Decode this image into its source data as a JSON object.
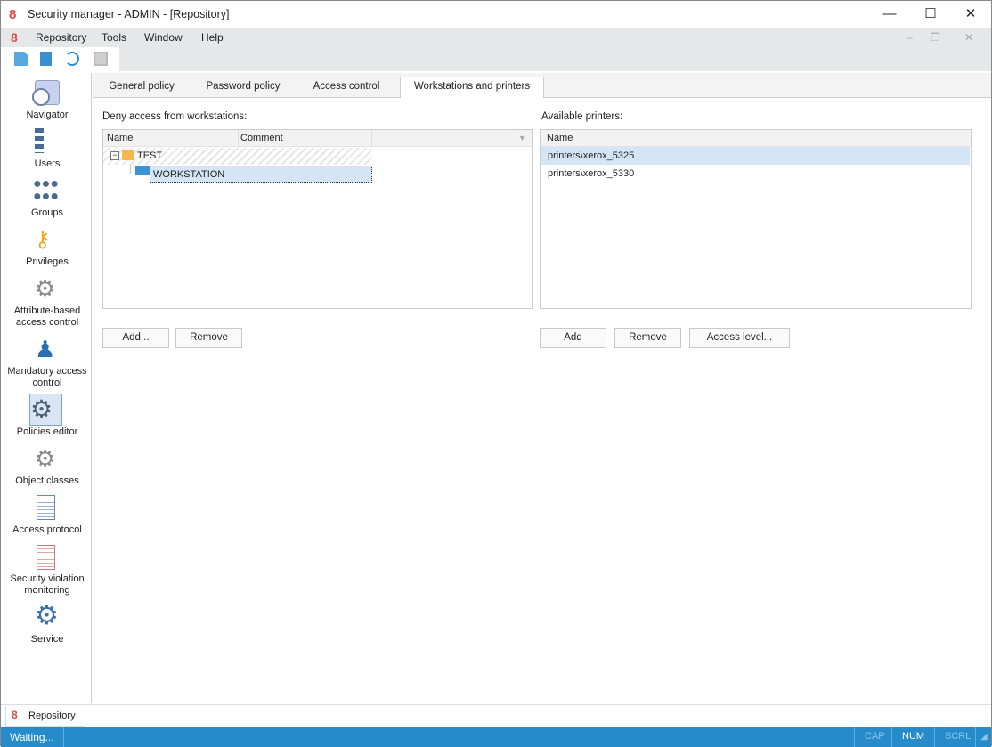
{
  "window": {
    "title": "Security manager - ADMIN - [Repository]",
    "minimize": "—",
    "maximize": "☐",
    "close": "✕"
  },
  "menu": {
    "items": [
      "Repository",
      "Tools",
      "Window",
      "Help"
    ]
  },
  "sidebar": {
    "items": [
      {
        "label": "Navigator",
        "icon": "navigator-icon"
      },
      {
        "label": "Users",
        "icon": "users-icon"
      },
      {
        "label": "Groups",
        "icon": "groups-icon"
      },
      {
        "label": "Privileges",
        "icon": "key-icon"
      },
      {
        "label": "Attribute-based access control",
        "icon": "abac-icon"
      },
      {
        "label": "Mandatory access control",
        "icon": "mandatory-icon"
      },
      {
        "label": "Policies editor",
        "icon": "policies-icon",
        "active": true
      },
      {
        "label": "Object classes",
        "icon": "object-classes-icon"
      },
      {
        "label": "Access protocol",
        "icon": "protocol-icon"
      },
      {
        "label": "Security violation monitoring",
        "icon": "violation-icon"
      },
      {
        "label": "Service",
        "icon": "gear-icon"
      }
    ]
  },
  "tabs": [
    "General policy",
    "Password policy",
    "Access control",
    "Workstations and printers"
  ],
  "workstations": {
    "label": "Deny access from workstations:",
    "columns": [
      "Name",
      "Comment"
    ],
    "tree": [
      {
        "name": "TEST",
        "children": [
          {
            "name": "WORKSTATION"
          }
        ]
      }
    ],
    "buttons": {
      "add": "Add...",
      "remove": "Remove"
    }
  },
  "printers": {
    "label": "Available printers:",
    "columns": [
      "Name"
    ],
    "rows": [
      "printers\\xerox_5325",
      "printers\\xerox_5330"
    ],
    "buttons": {
      "add": "Add",
      "remove": "Remove",
      "access": "Access level..."
    }
  },
  "bottom_tab": "Repository",
  "status": {
    "text": "Waiting...",
    "cap": "CAP",
    "num": "NUM",
    "scrl": "SCRL"
  },
  "colors": {
    "accent": "#268bcb",
    "selection": "#d4e6f5"
  }
}
